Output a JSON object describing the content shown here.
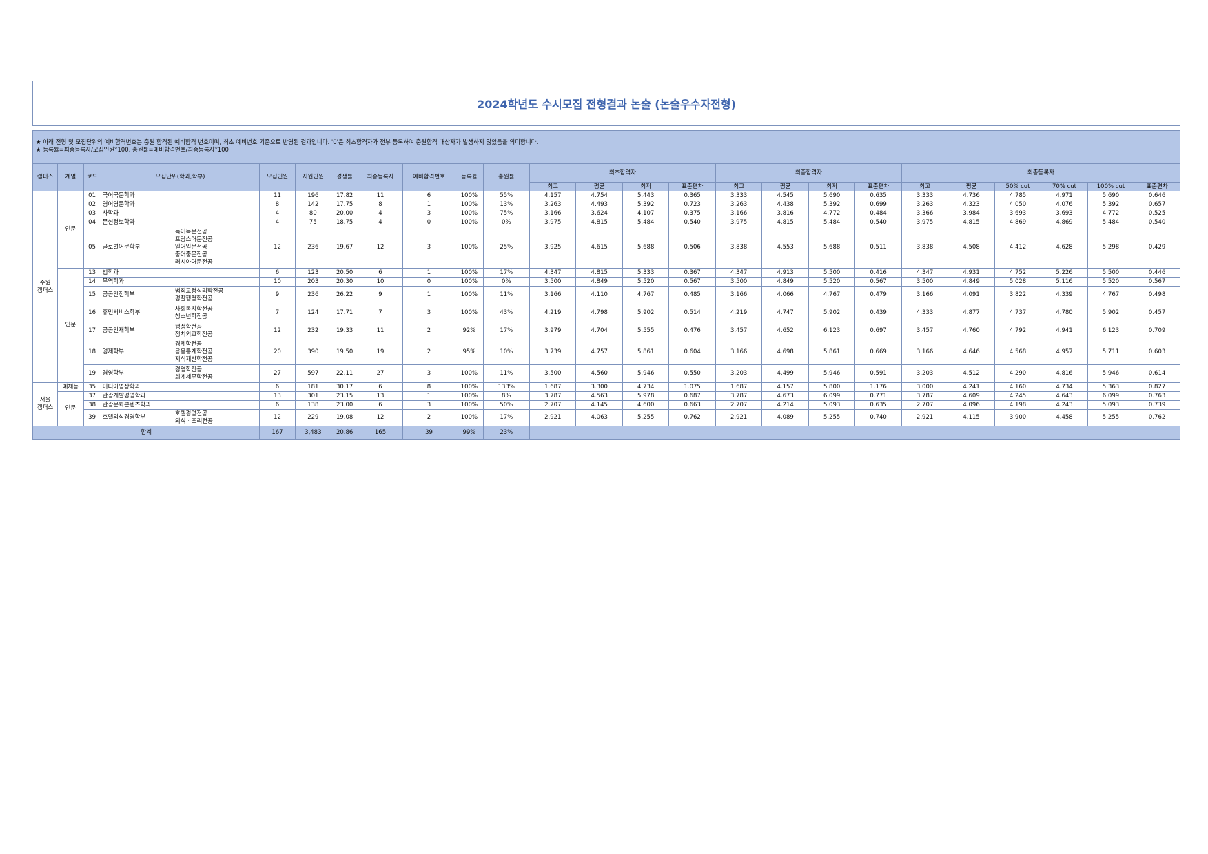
{
  "title": "2024학년도 수시모집 전형결과 논술 (논술우수자전형)",
  "notes": [
    "★ 아래 전형 및 모집단위의 예비합격번호는 충원 합격된 예비합격 번호이며, 최초 예비번호 기준으로 반영된 결과입니다. '0'은 최초합격자가 전부 등록하여 충원합격 대상자가 발생하지 않았음을 의미합니다.",
    "★ 등록률=최종등록자/모집인원*100, 충원률=예비합격번호/최종등록자*100"
  ],
  "headers": {
    "campus": "캠퍼스",
    "track": "계열",
    "code": "코드",
    "unit": "모집단위(학과,학부)",
    "quota": "모집인원",
    "applicants": "지원인원",
    "ratio": "경쟁률",
    "final_reg": "최종등록자",
    "waitlist": "예비합격번호",
    "reg_rate": "등록률",
    "fill_rate": "충원률",
    "first_pass": "최초합격자",
    "final_pass": "최종합격자",
    "final_enrolled": "최종등록자",
    "sub_pass": [
      "최고",
      "평균",
      "최저",
      "표준편차"
    ],
    "sub_enrolled": [
      "최고",
      "평균",
      "50% cut",
      "70% cut",
      "100% cut",
      "표준편차"
    ]
  },
  "campus_labels": {
    "suwon": "수원\n캠퍼스",
    "seoul": "서울\n캠퍼스"
  },
  "track_labels": {
    "humanities": "인문",
    "arts": "예체능"
  },
  "rows": [
    {
      "code": "01",
      "name": "국어국문학과",
      "majors": [],
      "c": [
        "11",
        "196",
        "17.82",
        "11",
        "6",
        "100%",
        "55%"
      ],
      "s": [
        "4.157",
        "4.754",
        "5.443",
        "0.365",
        "3.333",
        "4.545",
        "5.690",
        "0.635",
        "3.333",
        "4.736",
        "4.785",
        "4.971",
        "5.690",
        "0.646"
      ]
    },
    {
      "code": "02",
      "name": "영어영문학과",
      "majors": [],
      "c": [
        "8",
        "142",
        "17.75",
        "8",
        "1",
        "100%",
        "13%"
      ],
      "s": [
        "3.263",
        "4.493",
        "5.392",
        "0.723",
        "3.263",
        "4.438",
        "5.392",
        "0.699",
        "3.263",
        "4.323",
        "4.050",
        "4.076",
        "5.392",
        "0.657"
      ]
    },
    {
      "code": "03",
      "name": "사학과",
      "majors": [],
      "c": [
        "4",
        "80",
        "20.00",
        "4",
        "3",
        "100%",
        "75%"
      ],
      "s": [
        "3.166",
        "3.624",
        "4.107",
        "0.375",
        "3.166",
        "3.816",
        "4.772",
        "0.484",
        "3.366",
        "3.984",
        "3.693",
        "3.693",
        "4.772",
        "0.525"
      ]
    },
    {
      "code": "04",
      "name": "문헌정보학과",
      "majors": [],
      "c": [
        "4",
        "75",
        "18.75",
        "4",
        "0",
        "100%",
        "0%"
      ],
      "s": [
        "3.975",
        "4.815",
        "5.484",
        "0.540",
        "3.975",
        "4.815",
        "5.484",
        "0.540",
        "3.975",
        "4.815",
        "4.869",
        "4.869",
        "5.484",
        "0.540"
      ]
    },
    {
      "code": "05",
      "name": "글로벌어문학부",
      "majors": [
        "독어독문전공",
        "프랑스어문전공",
        "일어일문전공",
        "중어중문전공",
        "러시아어문전공"
      ],
      "c": [
        "12",
        "236",
        "19.67",
        "12",
        "3",
        "100%",
        "25%"
      ],
      "s": [
        "3.925",
        "4.615",
        "5.688",
        "0.506",
        "3.838",
        "4.553",
        "5.688",
        "0.511",
        "3.838",
        "4.508",
        "4.412",
        "4.628",
        "5.298",
        "0.429"
      ]
    },
    {
      "code": "13",
      "name": "법학과",
      "majors": [],
      "c": [
        "6",
        "123",
        "20.50",
        "6",
        "1",
        "100%",
        "17%"
      ],
      "s": [
        "4.347",
        "4.815",
        "5.333",
        "0.367",
        "4.347",
        "4.913",
        "5.500",
        "0.416",
        "4.347",
        "4.931",
        "4.752",
        "5.226",
        "5.500",
        "0.446"
      ]
    },
    {
      "code": "14",
      "name": "무역학과",
      "majors": [],
      "c": [
        "10",
        "203",
        "20.30",
        "10",
        "0",
        "100%",
        "0%"
      ],
      "s": [
        "3.500",
        "4.849",
        "5.520",
        "0.567",
        "3.500",
        "4.849",
        "5.520",
        "0.567",
        "3.500",
        "4.849",
        "5.028",
        "5.116",
        "5.520",
        "0.567"
      ]
    },
    {
      "code": "15",
      "name": "공공안전학부",
      "majors": [
        "범죄교정심리학전공",
        "경찰행정학전공"
      ],
      "c": [
        "9",
        "236",
        "26.22",
        "9",
        "1",
        "100%",
        "11%"
      ],
      "s": [
        "3.166",
        "4.110",
        "4.767",
        "0.485",
        "3.166",
        "4.066",
        "4.767",
        "0.479",
        "3.166",
        "4.091",
        "3.822",
        "4.339",
        "4.767",
        "0.498"
      ]
    },
    {
      "code": "16",
      "name": "휴먼서비스학부",
      "majors": [
        "사회복지학전공",
        "청소년학전공"
      ],
      "c": [
        "7",
        "124",
        "17.71",
        "7",
        "3",
        "100%",
        "43%"
      ],
      "s": [
        "4.219",
        "4.798",
        "5.902",
        "0.514",
        "4.219",
        "4.747",
        "5.902",
        "0.439",
        "4.333",
        "4.877",
        "4.737",
        "4.780",
        "5.902",
        "0.457"
      ]
    },
    {
      "code": "17",
      "name": "공공인재학부",
      "majors": [
        "행정학전공",
        "정치외교학전공"
      ],
      "c": [
        "12",
        "232",
        "19.33",
        "11",
        "2",
        "92%",
        "17%"
      ],
      "s": [
        "3.979",
        "4.704",
        "5.555",
        "0.476",
        "3.457",
        "4.652",
        "6.123",
        "0.697",
        "3.457",
        "4.760",
        "4.792",
        "4.941",
        "6.123",
        "0.709"
      ]
    },
    {
      "code": "18",
      "name": "경제학부",
      "majors": [
        "경제학전공",
        "응용통계학전공",
        "지식재산학전공"
      ],
      "c": [
        "20",
        "390",
        "19.50",
        "19",
        "2",
        "95%",
        "10%"
      ],
      "s": [
        "3.739",
        "4.757",
        "5.861",
        "0.604",
        "3.166",
        "4.698",
        "5.861",
        "0.669",
        "3.166",
        "4.646",
        "4.568",
        "4.957",
        "5.711",
        "0.603"
      ]
    },
    {
      "code": "19",
      "name": "경영학부",
      "majors": [
        "경영학전공",
        "회계세무학전공"
      ],
      "c": [
        "27",
        "597",
        "22.11",
        "27",
        "3",
        "100%",
        "11%"
      ],
      "s": [
        "3.500",
        "4.560",
        "5.946",
        "0.550",
        "3.203",
        "4.499",
        "5.946",
        "0.591",
        "3.203",
        "4.512",
        "4.290",
        "4.816",
        "5.946",
        "0.614"
      ]
    },
    {
      "code": "35",
      "name": "미디어영상학과",
      "majors": [],
      "c": [
        "6",
        "181",
        "30.17",
        "6",
        "8",
        "100%",
        "133%"
      ],
      "s": [
        "1.687",
        "3.300",
        "4.734",
        "1.075",
        "1.687",
        "4.157",
        "5.800",
        "1.176",
        "3.000",
        "4.241",
        "4.160",
        "4.734",
        "5.363",
        "0.827"
      ]
    },
    {
      "code": "37",
      "name": "관광개발경영학과",
      "majors": [],
      "c": [
        "13",
        "301",
        "23.15",
        "13",
        "1",
        "100%",
        "8%"
      ],
      "s": [
        "3.787",
        "4.563",
        "5.978",
        "0.687",
        "3.787",
        "4.673",
        "6.099",
        "0.771",
        "3.787",
        "4.609",
        "4.245",
        "4.643",
        "6.099",
        "0.763"
      ]
    },
    {
      "code": "38",
      "name": "관광문화콘텐츠학과",
      "majors": [],
      "c": [
        "6",
        "138",
        "23.00",
        "6",
        "3",
        "100%",
        "50%"
      ],
      "s": [
        "2.707",
        "4.145",
        "4.600",
        "0.663",
        "2.707",
        "4.214",
        "5.093",
        "0.635",
        "2.707",
        "4.096",
        "4.198",
        "4.243",
        "5.093",
        "0.739"
      ]
    },
    {
      "code": "39",
      "name": "호텔외식경영학부",
      "majors": [
        "호텔경영전공",
        "외식 · 조리전공"
      ],
      "c": [
        "12",
        "229",
        "19.08",
        "12",
        "2",
        "100%",
        "17%"
      ],
      "s": [
        "2.921",
        "4.063",
        "5.255",
        "0.762",
        "2.921",
        "4.089",
        "5.255",
        "0.740",
        "2.921",
        "4.115",
        "3.900",
        "4.458",
        "5.255",
        "0.762"
      ]
    }
  ],
  "total": {
    "label": "합계",
    "c": [
      "167",
      "3,483",
      "20.86",
      "165",
      "39",
      "99%",
      "23%"
    ]
  }
}
